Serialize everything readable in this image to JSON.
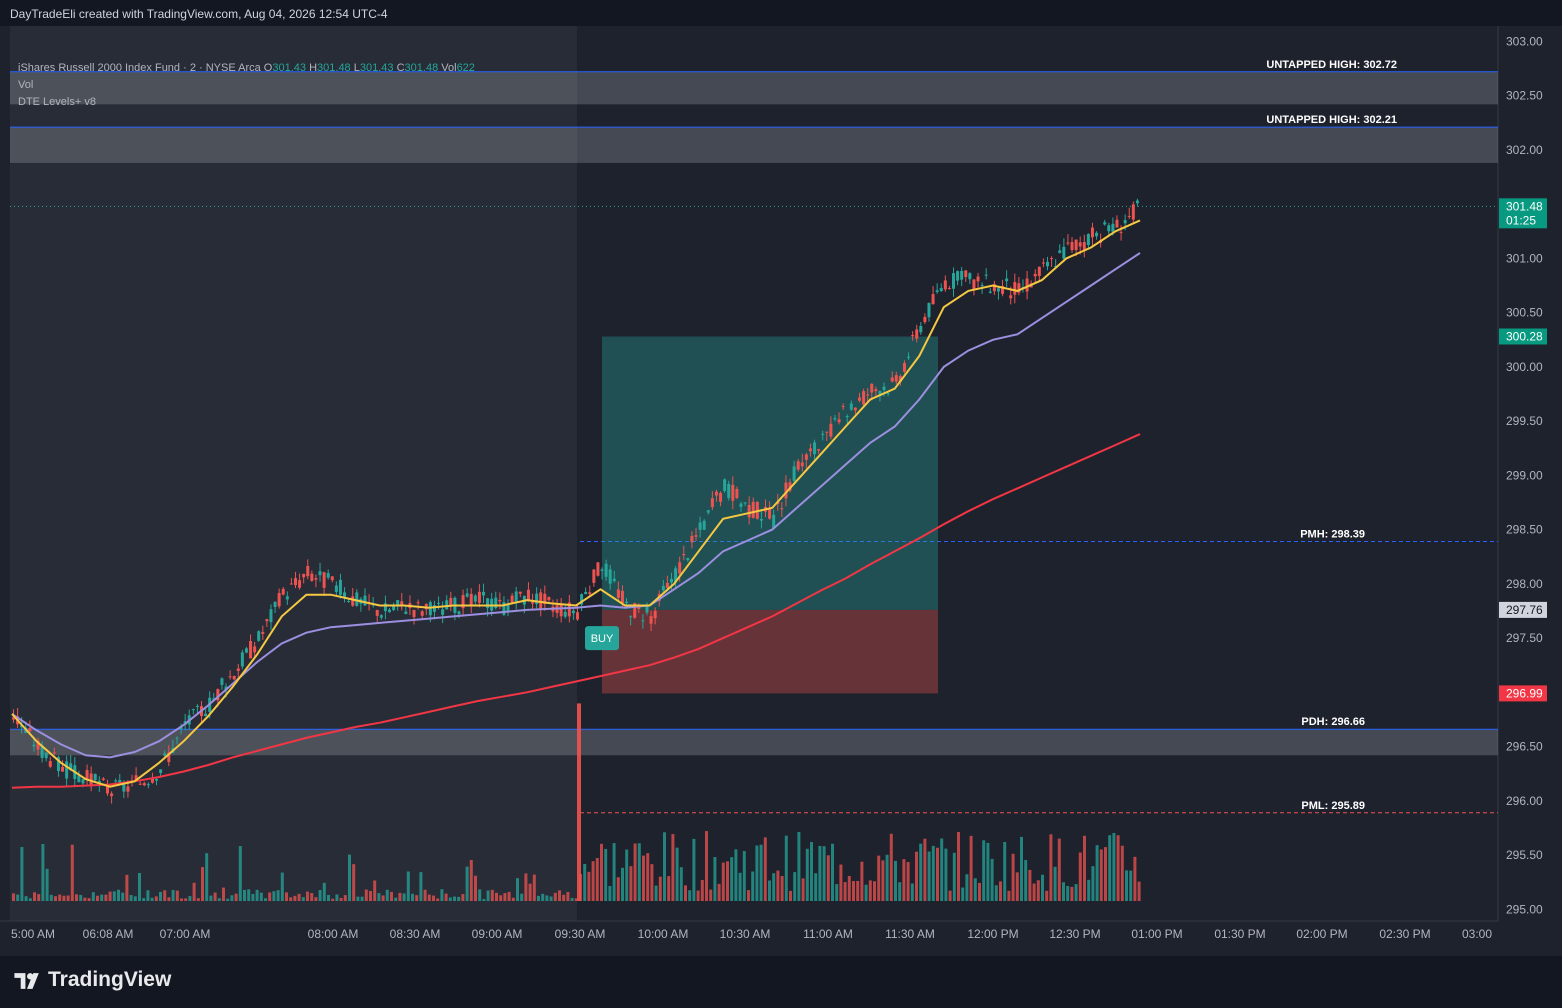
{
  "header": {
    "attribution": "DayTradeEli created with TradingView.com, Aug 04, 2026 12:54 UTC-4"
  },
  "legend": {
    "symbol": "iShares Russell 2000 Index Fund · 2 · NYSE Arca",
    "o_label": "O",
    "o": "301.43",
    "h_label": "H",
    "h": "301.48",
    "l_label": "L",
    "l": "301.43",
    "c_label": "C",
    "c": "301.48",
    "vol_label": "Vol",
    "vol": "622",
    "vol_indicator": "Vol",
    "indicator": "DTE Levels+ v8"
  },
  "footer": {
    "brand": "TradingView"
  },
  "buy_label": "BUY",
  "colors": {
    "up": "#26a69a",
    "down": "#ef5350",
    "ema_fast": "#f5c842",
    "ema_mid": "#9c8fe0",
    "ema_slow": "#f23645",
    "level_line": "#2962ff",
    "premarket_shade": "#2a2e39"
  },
  "chart_data": {
    "type": "candlestick",
    "ylim": [
      294.8,
      303.05
    ],
    "y_ticks": [
      "303.00",
      "302.50",
      "302.00",
      "301.50",
      "301.00",
      "300.50",
      "300.00",
      "299.50",
      "299.00",
      "298.50",
      "298.00",
      "297.50",
      "297.00",
      "296.50",
      "296.00",
      "295.50",
      "295.00"
    ],
    "x_ticks": [
      "5:00 AM",
      "06:08 AM",
      "07:00 AM",
      "08:00 AM",
      "08:30 AM",
      "09:00 AM",
      "09:30 AM",
      "10:00 AM",
      "10:30 AM",
      "11:00 AM",
      "11:30 AM",
      "12:00 PM",
      "12:30 PM",
      "01:00 PM",
      "01:30 PM",
      "02:00 PM",
      "02:30 PM",
      "03:00"
    ],
    "levels": [
      {
        "label": "UNTAPPED HIGH: 302.72",
        "value": 302.72
      },
      {
        "label": "UNTAPPED HIGH: 302.21",
        "value": 302.21
      },
      {
        "label": "PMH: 298.39",
        "value": 298.39
      },
      {
        "label": "PDH: 296.66",
        "value": 296.66
      },
      {
        "label": "PML: 295.89",
        "value": 295.89
      }
    ],
    "price_tags": [
      {
        "value": "301.48",
        "sub": "01:25"
      },
      {
        "value": "300.28"
      },
      {
        "value": "297.76"
      },
      {
        "value": "296.99"
      }
    ],
    "position": {
      "entry": 297.76,
      "target": 300.28,
      "stop": 296.99
    },
    "close_path": [
      296.8,
      296.5,
      296.3,
      296.2,
      296.1,
      296.15,
      296.3,
      296.7,
      296.9,
      297.2,
      297.5,
      297.9,
      298.1,
      298.0,
      297.85,
      297.75,
      297.8,
      297.75,
      297.8,
      297.85,
      297.8,
      297.9,
      297.8,
      297.75,
      298.2,
      297.8,
      297.7,
      298.1,
      298.5,
      298.9,
      298.7,
      298.6,
      299.1,
      299.3,
      299.6,
      299.8,
      299.85,
      300.4,
      300.8,
      300.8,
      300.75,
      300.7,
      300.9,
      301.1,
      301.2,
      301.3,
      301.48
    ],
    "ema_fast": [
      296.8,
      296.55,
      296.35,
      296.2,
      296.13,
      296.18,
      296.35,
      296.55,
      296.78,
      297.05,
      297.35,
      297.7,
      297.9,
      297.9,
      297.85,
      297.8,
      297.8,
      297.78,
      297.8,
      297.8,
      297.8,
      297.85,
      297.82,
      297.8,
      297.95,
      297.8,
      297.8,
      298.0,
      298.3,
      298.6,
      298.65,
      298.7,
      298.95,
      299.2,
      299.45,
      299.7,
      299.8,
      300.1,
      300.55,
      300.7,
      300.75,
      300.7,
      300.8,
      301.0,
      301.1,
      301.25,
      301.35
    ],
    "ema_mid": [
      296.8,
      296.65,
      296.52,
      296.42,
      296.4,
      296.45,
      296.55,
      296.7,
      296.88,
      297.08,
      297.28,
      297.45,
      297.55,
      297.6,
      297.62,
      297.64,
      297.66,
      297.68,
      297.7,
      297.72,
      297.74,
      297.76,
      297.77,
      297.78,
      297.8,
      297.78,
      297.8,
      297.95,
      298.1,
      298.3,
      298.4,
      298.5,
      298.7,
      298.9,
      299.1,
      299.3,
      299.45,
      299.7,
      300.0,
      300.15,
      300.25,
      300.3,
      300.45,
      300.6,
      300.75,
      300.9,
      301.05
    ],
    "ema_slow": [
      296.12,
      296.13,
      296.13,
      296.14,
      296.15,
      296.18,
      296.22,
      296.27,
      296.33,
      296.4,
      296.46,
      296.52,
      296.58,
      296.63,
      296.68,
      296.72,
      296.77,
      296.82,
      296.87,
      296.92,
      296.96,
      297.0,
      297.05,
      297.1,
      297.15,
      297.2,
      297.25,
      297.32,
      297.4,
      297.5,
      297.6,
      297.7,
      297.82,
      297.94,
      298.05,
      298.18,
      298.3,
      298.42,
      298.55,
      298.67,
      298.78,
      298.88,
      298.98,
      299.08,
      299.18,
      299.28,
      299.38
    ]
  }
}
